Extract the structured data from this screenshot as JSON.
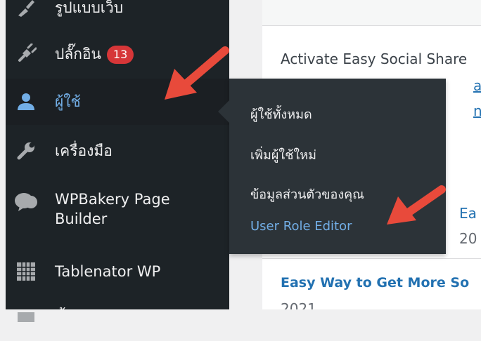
{
  "sidebar": {
    "items": [
      {
        "label": "รูปแบบเว็บ",
        "icon": "brush-icon"
      },
      {
        "label": "ปลั๊กอิน",
        "badge": "13",
        "icon": "plug-icon"
      },
      {
        "label": "ผู้ใช้",
        "icon": "user-icon"
      },
      {
        "label": "เครื่องมือ",
        "icon": "wrench-icon"
      },
      {
        "label": "WPBakery Page Builder",
        "label_line1": "WPBakery Page",
        "label_line2": "Builder",
        "icon": "speech-bubble-icon"
      },
      {
        "label": "Tablenator WP",
        "icon": "table-icon"
      },
      {
        "label": "ตั้งค่า",
        "icon": "settings-icon"
      }
    ]
  },
  "submenu": {
    "items": [
      {
        "label": "ผู้ใช้ทั้งหมด"
      },
      {
        "label": "เพิ่มผู้ใช้ใหม่"
      },
      {
        "label": "ข้อมูลส่วนตัวของคุณ"
      },
      {
        "label": "User Role Editor"
      }
    ]
  },
  "content": {
    "notice_text": "Activate Easy Social Share",
    "notice_link1": "ate",
    "notice_link2": "nce",
    "post_partial_title": "Ea",
    "post_partial_date": "20",
    "post_title": "Easy Way to Get More So",
    "post_date": "2021"
  },
  "colors": {
    "sidebar_bg": "#1d2327",
    "submenu_bg": "#2c3338",
    "accent_blue": "#72aee6",
    "badge_red": "#d63638",
    "arrow_red": "#e84a3b"
  }
}
